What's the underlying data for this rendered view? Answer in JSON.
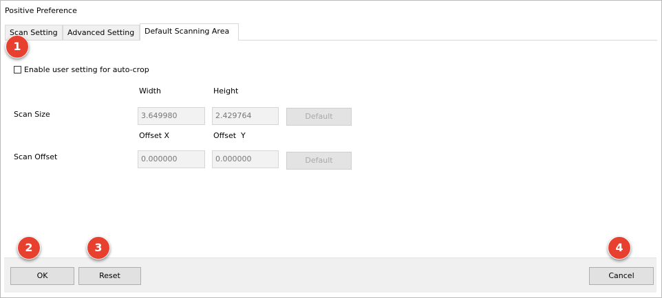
{
  "window": {
    "title": "Positive Preference"
  },
  "tabs": [
    {
      "label": "Scan Setting"
    },
    {
      "label": "Advanced Setting"
    },
    {
      "label": "Default Scanning Area"
    }
  ],
  "auto_crop": {
    "label": "Enable user setting for auto-crop",
    "checked": false
  },
  "scan_size": {
    "label": "Scan Size",
    "width_header": "Width",
    "height_header": "Height",
    "width_value": "3.649980",
    "height_value": "2.429764",
    "default_label": "Default"
  },
  "scan_offset": {
    "label": "Scan Offset",
    "x_header": "Offset X",
    "y_header": "Offset  Y",
    "x_value": "0.000000",
    "y_value": "0.000000",
    "default_label": "Default"
  },
  "footer": {
    "ok_label": "OK",
    "reset_label": "Reset",
    "cancel_label": "Cancel"
  },
  "badges": [
    "1",
    "2",
    "3",
    "4"
  ],
  "colors": {
    "badge": "#e8402f",
    "disabled_text": "#a8a8a8"
  }
}
